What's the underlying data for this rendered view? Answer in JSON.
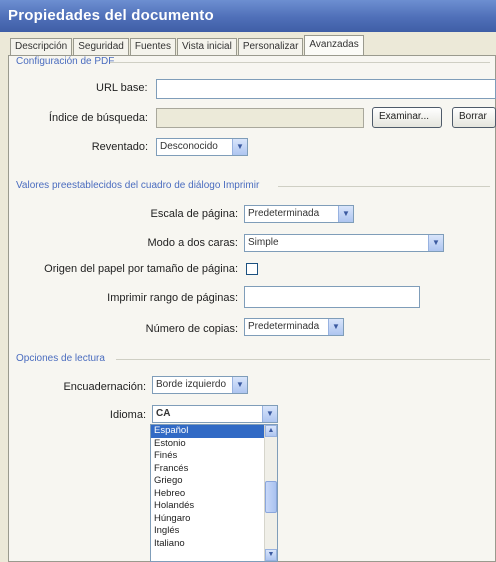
{
  "window": {
    "title": "Propiedades del documento"
  },
  "tabs": [
    {
      "label": "Descripción"
    },
    {
      "label": "Seguridad"
    },
    {
      "label": "Fuentes"
    },
    {
      "label": "Vista inicial"
    },
    {
      "label": "Personalizar"
    },
    {
      "label": "Avanzadas",
      "active": true
    }
  ],
  "pdf_config": {
    "title": "Configuración de PDF",
    "base_url_label": "URL base:",
    "base_url_value": "",
    "search_index_label": "Índice de búsqueda:",
    "search_index_value": "",
    "browse_button": "Examinar...",
    "clear_button": "Borrar",
    "trapped_label": "Reventado:",
    "trapped_value": "Desconocido"
  },
  "print_defaults": {
    "title": "Valores preestablecidos del cuadro de diálogo Imprimir",
    "page_scaling_label": "Escala de página:",
    "page_scaling_value": "Predeterminada",
    "duplex_label": "Modo a dos caras:",
    "duplex_value": "Simple",
    "paper_source_label": "Origen del papel por tamaño de página:",
    "paper_source_checked": false,
    "print_range_label": "Imprimir rango de páginas:",
    "print_range_value": "",
    "copies_label": "Número de copias:",
    "copies_value": "Predeterminada"
  },
  "reading_options": {
    "title": "Opciones de lectura",
    "binding_label": "Encuadernación:",
    "binding_value": "Borde izquierdo",
    "language_label": "Idioma:",
    "language_value": "CA",
    "language_options": [
      "Español",
      "Estonio",
      "Finés",
      "Francés",
      "Griego",
      "Hebreo",
      "Holandés",
      "Húngaro",
      "Inglés",
      "Italiano"
    ],
    "language_selected_index": 0
  }
}
